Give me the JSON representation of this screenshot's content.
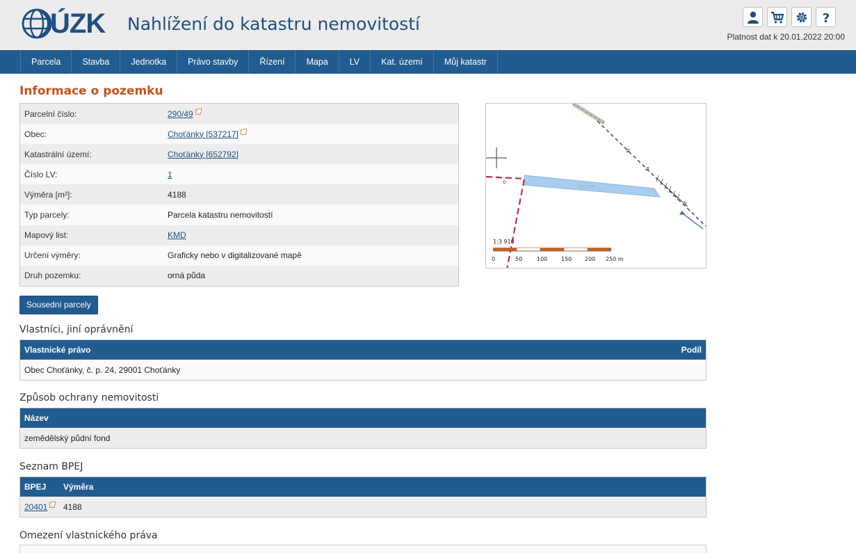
{
  "header": {
    "logo_text": "ÚZK",
    "app_title": "Nahlížení do katastru nemovitostí",
    "validity": "Platnost dat k 20.01.2022 20:00",
    "icons": [
      "user-icon",
      "cart-icon",
      "gear-icon",
      "help-icon"
    ]
  },
  "nav": {
    "items": [
      "Parcela",
      "Stavba",
      "Jednotka",
      "Právo stavby",
      "Řízení",
      "Mapa",
      "LV",
      "Kat. území",
      "Můj katastr"
    ]
  },
  "page_title": "Informace o pozemku",
  "info": {
    "rows": [
      {
        "label": "Parcelní číslo:",
        "value": "290/49",
        "link": true,
        "ext": true
      },
      {
        "label": "Obec:",
        "value": "Choťánky [537217]",
        "link": true,
        "ext": true
      },
      {
        "label": "Katastrální území:",
        "value": "Choťánky [652792]",
        "link": true,
        "ext": false
      },
      {
        "label": "Číslo LV:",
        "value": "1",
        "link": true,
        "ext": false
      },
      {
        "label": "Výměra [m²]:",
        "value": "4188",
        "link": false,
        "ext": false
      },
      {
        "label": "Typ parcely:",
        "value": "Parcela katastru nemovitostí",
        "link": false,
        "ext": false
      },
      {
        "label": "Mapový list:",
        "value": "KMD",
        "link": true,
        "ext": false
      },
      {
        "label": "Určení výměry:",
        "value": "Graficky nebo v digitalizované mapě",
        "link": false,
        "ext": false
      },
      {
        "label": "Druh pozemku:",
        "value": "orná půda",
        "link": false,
        "ext": false
      }
    ]
  },
  "map": {
    "scale_label": "1:3 910",
    "scale_ticks": [
      "0",
      "50",
      "100",
      "150",
      "200",
      "250 m"
    ],
    "parcel_label": "ecúm"
  },
  "neighbours_button": "Sousední parcely",
  "owners": {
    "title": "Vlastníci, jiní oprávnění",
    "col1": "Vlastnické právo",
    "col2": "Podíl",
    "row": "Obec Choťánky, č. p. 24, 29001 Choťánky"
  },
  "protection": {
    "title": "Způsob ochrany nemovitosti",
    "col1": "Název",
    "row": "zemědělský půdní fond"
  },
  "bpej": {
    "title": "Seznam BPEJ",
    "col1": "BPEJ",
    "col2": "Výměra",
    "code": "20401",
    "area": "4188"
  },
  "restrictions": {
    "title": "Omezení vlastnického práva"
  },
  "colors": {
    "brand": "#225b8f",
    "title_accent": "#c2531d",
    "parcel_fill": "#a9cdee",
    "boundary": "#c0265a"
  }
}
